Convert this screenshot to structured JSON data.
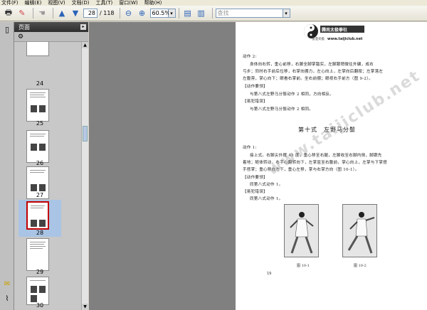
{
  "menu": {
    "file": "文件(F)",
    "edit": "编辑(E)",
    "view": "视图(V)",
    "document": "文档(D)",
    "tools": "工具(T)",
    "window": "窗口(W)",
    "help": "帮助(H)"
  },
  "toolbar": {
    "current_page": "28",
    "total_pages": "/ 118",
    "zoom": "60.5%",
    "search_placeholder": "查找"
  },
  "panel": {
    "title": "页面"
  },
  "thumbnails": [
    {
      "label": "24"
    },
    {
      "label": "25"
    },
    {
      "label": "26"
    },
    {
      "label": "27"
    },
    {
      "label": "28"
    },
    {
      "label": "29"
    },
    {
      "label": "30"
    }
  ],
  "document": {
    "logo_text": "腾尚太极拳社",
    "logo_url": "www.taijiclub.net",
    "logo_sub": "张澄天极",
    "watermark": "www.taijiclub.net",
    "lines": [
      "动作 2:",
      "身体向右转，重心前移，右脚全脚掌踏实，左脚跟稍微往外碾，成右",
      "弓步；同时右手前后位移，右掌向掤力，左心向上，左掌向后翻按；左掌落左",
      "左腹旁，掌心向下；眼看右掌前。坐右前掤；眼视右手前方（图 9-2）。",
      "【动作要领】",
      "与第八式左野马分鬃动作 2 相同，方向相反。",
      "【易犯错误】",
      "与第八式左野马分鬃动作 2 相同。",
      "第十式　左野马分鬃",
      "动作 1:",
      "接上式。右脚尖外摆 45 度，重心移至右腿，左脚收至右脚内侧，脚跟先",
      "着地；随体转动，右手心翻转向下，左掌屈至右腹前，掌心向上，左掌与下掌搭",
      "手搭掌；重心移向左下，重心左移，掌与右掌方向（图 10-1）。",
      "【动作要领】",
      "同第八式动作 1。",
      "【易犯错误】",
      "同第八式动作 1。"
    ],
    "caption_left": "图 10-1",
    "caption_right": "图 10-2",
    "page_number": "19"
  }
}
